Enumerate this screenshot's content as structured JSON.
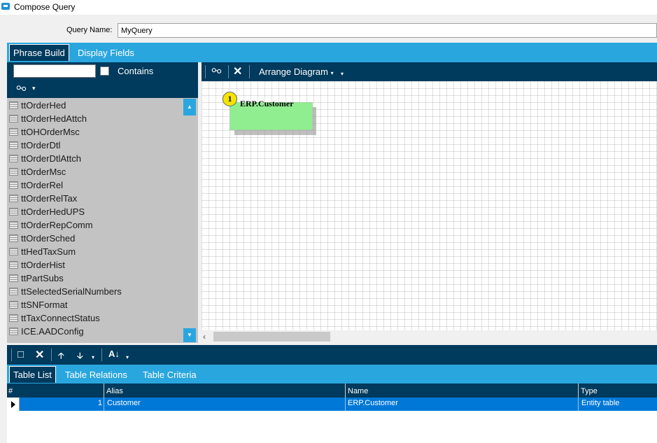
{
  "window": {
    "title": "Compose Query"
  },
  "query": {
    "label": "Query Name:",
    "value": "MyQuery"
  },
  "main_tabs": [
    {
      "label": "Phrase Build",
      "active": true
    },
    {
      "label": "Display Fields",
      "active": false
    }
  ],
  "left_panel": {
    "search_value": "",
    "contains_label": "Contains",
    "contains_checked": false,
    "tables": [
      "ttOrderHed",
      "ttOrderHedAttch",
      "ttOHOrderMsc",
      "ttOrderDtl",
      "ttOrderDtlAttch",
      "ttOrderMsc",
      "ttOrderRel",
      "ttOrderRelTax",
      "ttOrderHedUPS",
      "ttOrderRepComm",
      "ttOrderSched",
      "ttHedTaxSum",
      "ttOrderHist",
      "ttPartSubs",
      "ttSelectedSerialNumbers",
      "ttSNFormat",
      "ttTaxConnectStatus",
      "ICE.AADConfig"
    ]
  },
  "diagram": {
    "arrange_label": "Arrange Diagram",
    "nodes": [
      {
        "number": "1",
        "title": "ERP.Customer",
        "color": "#90ee90"
      }
    ]
  },
  "bottom_tabs": [
    {
      "label": "Table List",
      "active": true
    },
    {
      "label": "Table Relations",
      "active": false
    },
    {
      "label": "Table Criteria",
      "active": false
    }
  ],
  "grid": {
    "columns": [
      "#",
      "Alias",
      "Name",
      "Type"
    ],
    "rows": [
      {
        "num": "1",
        "alias": "Customer",
        "name": "ERP.Customer",
        "type": "Entity table"
      }
    ]
  },
  "colors": {
    "accent": "#2aa6de",
    "dark": "#003a5c",
    "selection": "#0078d7",
    "node": "#90ee90",
    "badge": "#f5e400"
  }
}
